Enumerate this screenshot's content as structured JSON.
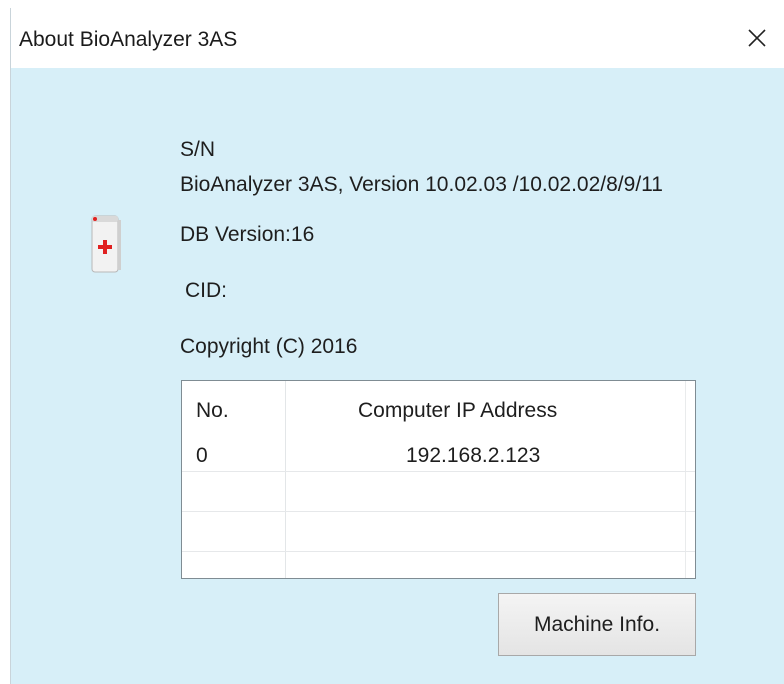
{
  "window": {
    "title": "About BioAnalyzer 3AS",
    "close_icon": "close-icon"
  },
  "about": {
    "icon": "first-aid-kit-icon",
    "sn_label": "S/N",
    "version_line": "BioAnalyzer 3AS, Version 10.02.03 /10.02.02/8/9/11",
    "db_version": "DB Version:16",
    "cid": "CID:",
    "copyright": "Copyright (C) 2016"
  },
  "ip_table": {
    "headers": [
      "No.",
      "Computer IP Address"
    ],
    "rows": [
      {
        "no": "0",
        "ip": "192.168.2.123"
      }
    ]
  },
  "buttons": {
    "machine_info": "Machine Info."
  },
  "colors": {
    "dialog_bg": "#d7eff8",
    "accent_red": "#e02020"
  }
}
